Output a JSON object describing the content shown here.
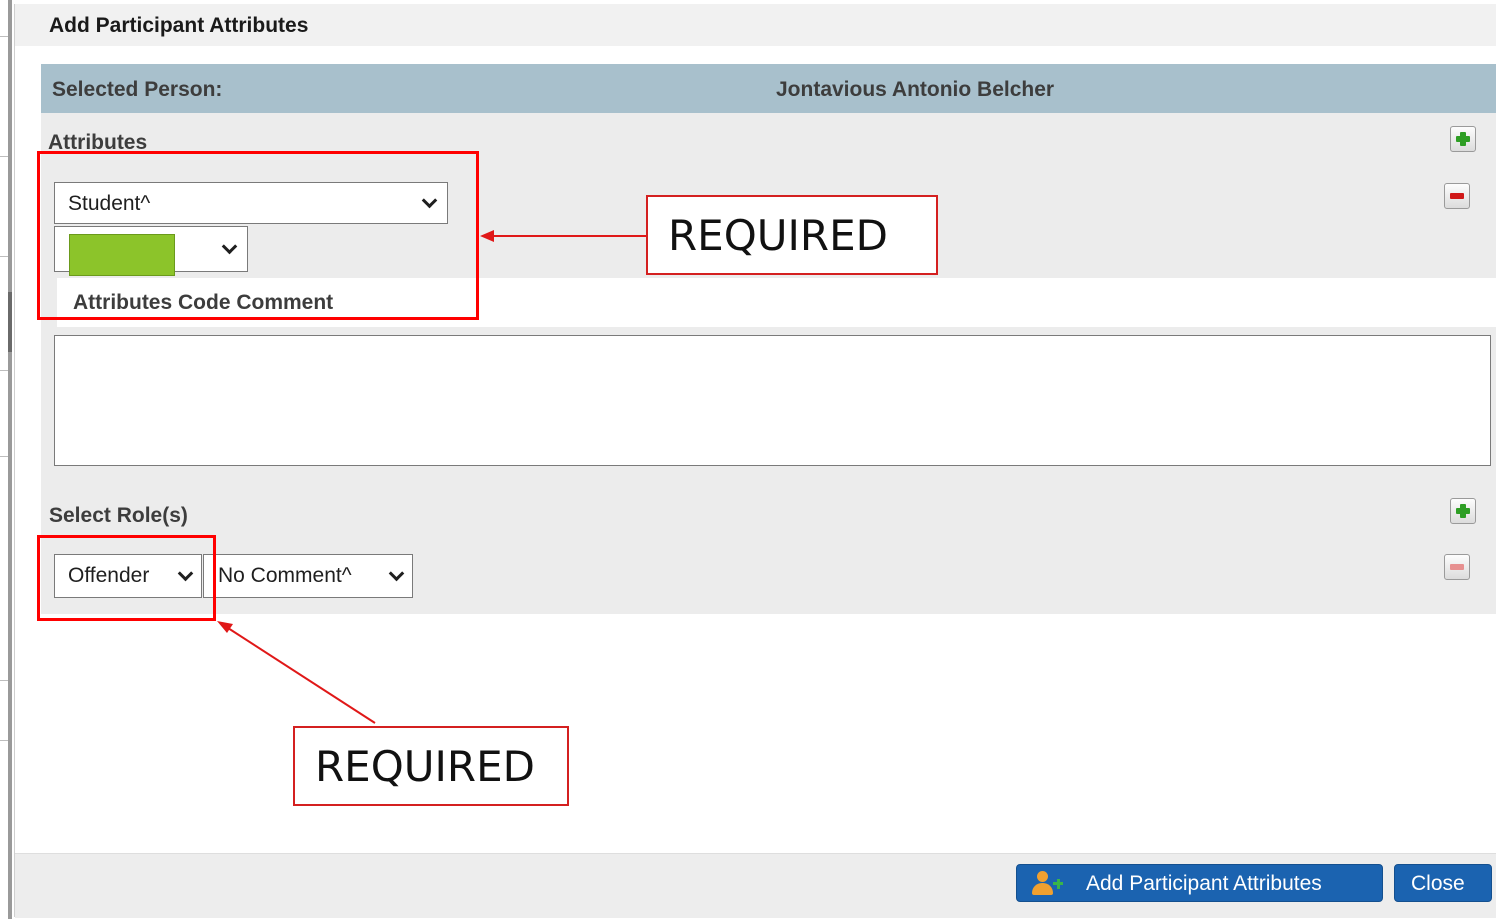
{
  "dialog": {
    "title": "Add Participant Attributes"
  },
  "person": {
    "label": "Selected Person:",
    "name": "Jontavious Antonio Belcher"
  },
  "attributes": {
    "section_label": "Attributes",
    "attribute_select_value": "Student^",
    "code_select_color": "#8cc42a",
    "comment_label": "Attributes Code Comment",
    "comment_value": ""
  },
  "roles": {
    "section_label": "Select Role(s)",
    "role_select_value": "Offender",
    "comment_select_value": "No Comment^"
  },
  "footer": {
    "add_button_label": "Add Participant Attributes",
    "close_button_label": "Close"
  },
  "annotations": {
    "callout_1": "REQUIRED",
    "callout_2": "REQUIRED",
    "color": "#ff0000"
  },
  "icons": {
    "add": "plus-icon",
    "remove": "minus-icon",
    "add_participant": "people-add-icon",
    "dropdown": "chevron-down-icon"
  }
}
